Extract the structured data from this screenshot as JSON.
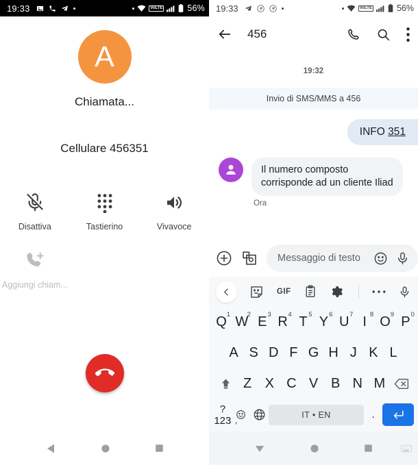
{
  "left_screen": {
    "status_bar": {
      "time": "19:33",
      "icons": [
        "image-icon",
        "phone-call-icon",
        "telegram-icon",
        "dot-icon"
      ],
      "right_icons": [
        "dot-icon",
        "wifi-icon",
        "volte-badge",
        "signal-icon",
        "battery-icon"
      ],
      "volte_label": "VoLTE",
      "battery": "56%"
    },
    "avatar_letter": "A",
    "avatar_color": "#f4943f",
    "call_state": "Chiamata...",
    "call_number": "Cellulare 456351",
    "actions": [
      {
        "icon": "mic-off-icon",
        "label": "Disattiva",
        "disabled": false
      },
      {
        "icon": "dialpad-icon",
        "label": "Tastierino",
        "disabled": false
      },
      {
        "icon": "speaker-icon",
        "label": "Vivavoce",
        "disabled": false
      }
    ],
    "actions_row2": [
      {
        "icon": "add-call-icon",
        "label": "Aggiungi chiam...",
        "disabled": true
      }
    ],
    "end_call": {
      "icon": "end-call-icon",
      "color": "#e02b27"
    },
    "nav": [
      "back-icon",
      "home-icon",
      "recents-icon"
    ]
  },
  "right_screen": {
    "status_bar": {
      "time": "19:33",
      "icons": [
        "telegram-icon",
        "pinterest-icon",
        "pinterest-icon",
        "dot-icon"
      ],
      "right_icons": [
        "dot-icon",
        "wifi-icon",
        "volte-badge",
        "signal-icon",
        "battery-icon"
      ],
      "volte_label": "VoLTE",
      "battery": "56%"
    },
    "header": {
      "back": "back-arrow-icon",
      "title": "456",
      "actions": [
        "phone-icon",
        "search-icon",
        "overflow-menu-icon"
      ]
    },
    "thread": {
      "day_time": "19:32",
      "system_banner": "Invio di SMS/MMS a 456",
      "sent": {
        "text_prefix": "INFO ",
        "text_underlined": "351"
      },
      "received": {
        "avatar_icon": "person-icon",
        "avatar_color": "#ab47d6",
        "line1": "Il numero composto",
        "line2": "corrisponde ad un cliente Iliad",
        "time": "Ora"
      }
    },
    "compose": {
      "plus": "plus-circle-icon",
      "gallery": "gallery-camera-icon",
      "placeholder": "Messaggio di testo",
      "emoji": "emoji-icon",
      "mic": "mic-icon"
    },
    "keyboard": {
      "toolbar": [
        "chevron-left-icon",
        "sticker-icon",
        "gif-label",
        "clipboard-icon",
        "settings-gear-icon",
        "more-dots-icon",
        "mic-icon"
      ],
      "gif_label": "GIF",
      "row1": [
        {
          "letter": "Q",
          "num": "1"
        },
        {
          "letter": "W",
          "num": "2"
        },
        {
          "letter": "E",
          "num": "3"
        },
        {
          "letter": "R",
          "num": "4"
        },
        {
          "letter": "T",
          "num": "5"
        },
        {
          "letter": "Y",
          "num": "6"
        },
        {
          "letter": "U",
          "num": "7"
        },
        {
          "letter": "I",
          "num": "8"
        },
        {
          "letter": "O",
          "num": "9"
        },
        {
          "letter": "P",
          "num": "0"
        }
      ],
      "row2": [
        "A",
        "S",
        "D",
        "F",
        "G",
        "H",
        "J",
        "K",
        "L"
      ],
      "row3": [
        "Z",
        "X",
        "C",
        "V",
        "B",
        "N",
        "M"
      ],
      "shift": "shift-icon",
      "backspace": "backspace-icon",
      "symbols_key": "?123",
      "globe": "language-globe-icon",
      "spacebar": "IT • EN",
      "period": ".",
      "enter": "enter-icon",
      "comma": ","
    },
    "nav": [
      "hide-keyboard-icon",
      "home-icon",
      "recents-icon",
      "keyboard-indicator-icon"
    ]
  }
}
